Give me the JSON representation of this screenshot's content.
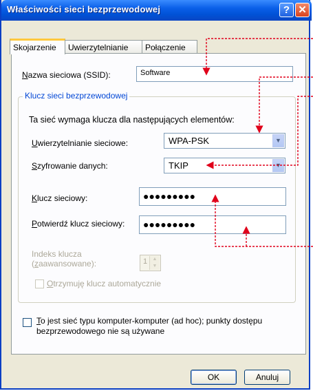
{
  "window": {
    "title": "Właściwości sieci bezprzewodowej",
    "help_glyph": "?",
    "close_glyph": "✕"
  },
  "tabs": [
    {
      "label": "Skojarzenie",
      "active": true
    },
    {
      "label": "Uwierzytelnianie",
      "active": false
    },
    {
      "label": "Połączenie",
      "active": false
    }
  ],
  "ssid": {
    "label_u": "N",
    "label_rest": "azwa sieciowa (SSID):",
    "value": "Software"
  },
  "group": {
    "title": "Klucz sieci bezprzewodowej",
    "description": "Ta sieć wymaga klucza dla następujących elementów:"
  },
  "auth": {
    "label_u": "U",
    "label_rest": "wierzytelnianie sieciowe:",
    "value": "WPA-PSK"
  },
  "enc": {
    "label_u": "S",
    "label_rest": "zyfrowanie danych:",
    "value": "TKIP"
  },
  "key": {
    "label_u": "K",
    "label_rest": "lucz sieciowy:",
    "value": "●●●●●●●●●"
  },
  "confirm": {
    "label_u": "P",
    "label_rest": "otwierdź klucz sieciowy:",
    "value": "●●●●●●●●●"
  },
  "index": {
    "label_line1": "Indeks klucza",
    "label_u": "z",
    "label_rest": "aawansowane):",
    "label_prefix": "(",
    "value": "1",
    "up": "▲",
    "down": "▼"
  },
  "auto_key": {
    "label_u": "O",
    "label_rest": "trzymuję klucz automatycznie",
    "checked": false
  },
  "adhoc": {
    "label_u": "T",
    "label_rest": "o jest sieć typu komputer-komputer (ad hoc); punkty dostępu",
    "label_line2": "bezprzewodowego nie są używane",
    "checked": false
  },
  "buttons": {
    "ok": "OK",
    "cancel": "Anuluj"
  },
  "dropdown_glyph": "▼",
  "colors": {
    "titlebar": "#0a5fe8",
    "annotation": "#e0001a",
    "group_title": "#0046d5"
  }
}
